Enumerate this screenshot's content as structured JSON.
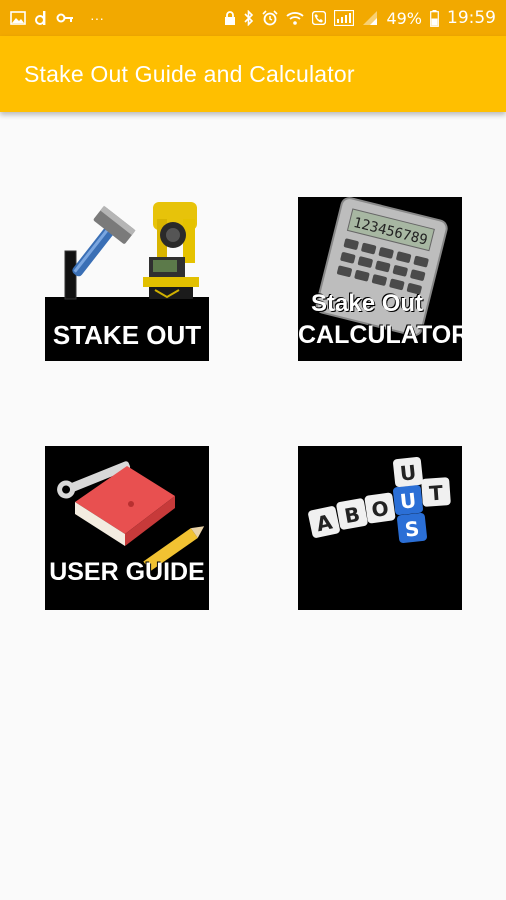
{
  "status_bar": {
    "time": "19:59",
    "battery_percent": "49%",
    "overflow": "···"
  },
  "app_bar": {
    "title": "Stake Out Guide and Calculator"
  },
  "tiles": [
    {
      "label": "STAKE OUT",
      "icon": "hammer-and-total-station-icon"
    },
    {
      "label_line1": "Stake Out",
      "label_line2": "CALCULATOR",
      "icon": "calculator-icon",
      "display": "123456789"
    },
    {
      "label": "USER GUIDE",
      "icon": "book-wrench-pencil-icon"
    },
    {
      "letters": [
        "A",
        "B",
        "O",
        "U",
        "T",
        "U",
        "S"
      ],
      "icon": "about-us-blocks-icon"
    }
  ],
  "colors": {
    "status_bar": "#f2a900",
    "app_bar": "#ffbf00",
    "background": "#fafafa"
  }
}
